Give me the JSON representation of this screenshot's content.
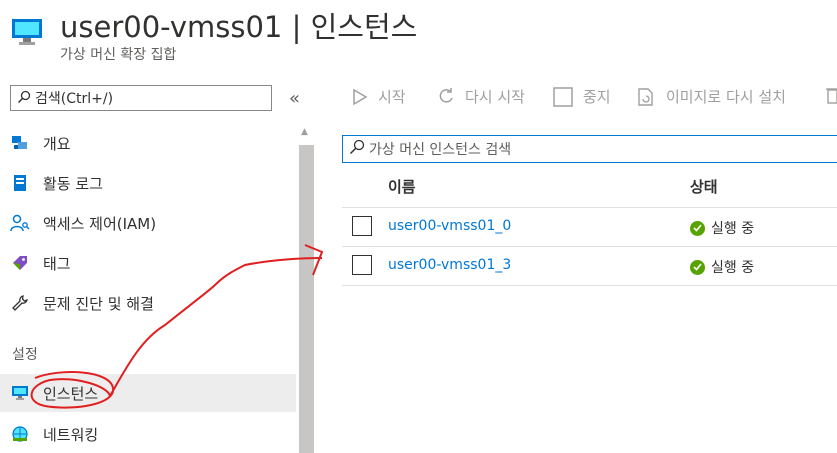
{
  "header": {
    "title": "user00-vmss01 | 인스턴스",
    "subtitle": "가상 머신 확장 집합"
  },
  "sidebar": {
    "search_placeholder": "검색(Ctrl+/)",
    "collapse_glyph": "«",
    "items": [
      {
        "label": "개요",
        "icon": "overview-icon"
      },
      {
        "label": "활동 로그",
        "icon": "activity-log-icon"
      },
      {
        "label": "액세스 제어(IAM)",
        "icon": "iam-icon"
      },
      {
        "label": "태그",
        "icon": "tag-icon"
      },
      {
        "label": "문제 진단 및 해결",
        "icon": "wrench-icon"
      }
    ],
    "section_label": "설정",
    "settings_items": [
      {
        "label": "인스턴스",
        "icon": "instances-icon",
        "active": true
      },
      {
        "label": "네트워킹",
        "icon": "networking-icon"
      }
    ]
  },
  "toolbar": {
    "start": "시작",
    "restart": "다시 시작",
    "stop": "중지",
    "reimage": "이미지로 다시 설치"
  },
  "instances": {
    "search_placeholder": "가상 머신 인스턴스 검색",
    "columns": [
      "이름",
      "상태"
    ],
    "rows": [
      {
        "name": "user00-vmss01_0",
        "status": "실행 중"
      },
      {
        "name": "user00-vmss01_3",
        "status": "실행 중"
      }
    ]
  },
  "colors": {
    "link": "#0078d4",
    "running": "#57a300",
    "annotation": "#e02020"
  }
}
